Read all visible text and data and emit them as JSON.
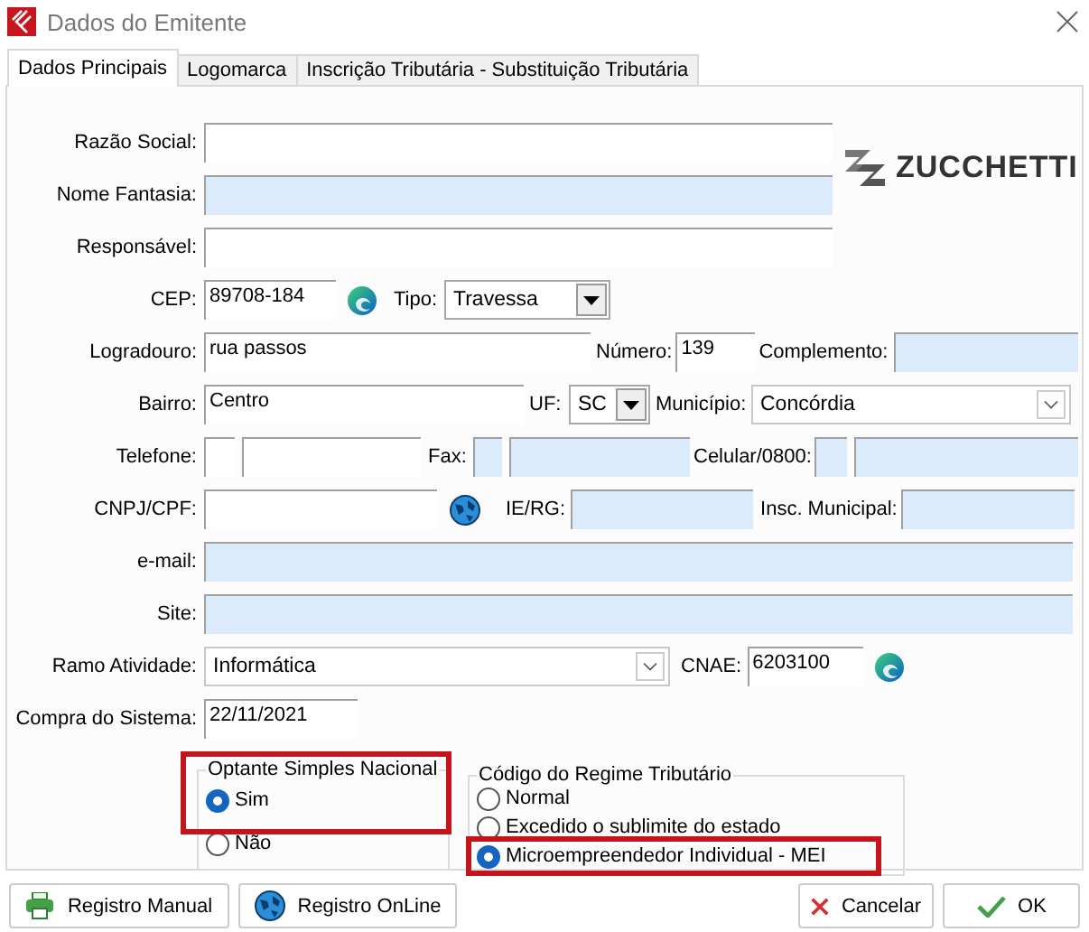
{
  "window": {
    "title": "Dados do Emitente"
  },
  "tabs": [
    {
      "label": "Dados Principais",
      "selected": true
    },
    {
      "label": "Logomarca",
      "selected": false
    },
    {
      "label": "Inscrição Tributária - Substituição Tributária",
      "selected": false
    }
  ],
  "logo": {
    "text": "ZUCCHETTI"
  },
  "rows": [
    {
      "items": [
        {
          "kind": "label",
          "text": "Razão Social:"
        },
        {
          "kind": "field",
          "shaded": false
        }
      ]
    },
    {
      "items": [
        {
          "kind": "label",
          "text": "Nome Fantasia:"
        },
        {
          "kind": "field",
          "shaded": true
        }
      ]
    },
    {
      "items": [
        {
          "kind": "label",
          "text": "Responsável:"
        },
        {
          "kind": "field",
          "shaded": false
        }
      ]
    },
    {
      "items": [
        {
          "kind": "label",
          "text": "CEP:"
        },
        {
          "kind": "field",
          "value": "89708-184",
          "shaded": false
        },
        {
          "kind": "label",
          "text": "Tipo:"
        },
        {
          "kind": "select",
          "value": "Travessa"
        }
      ]
    },
    {
      "items": [
        {
          "kind": "label",
          "text": "Logradouro:"
        },
        {
          "kind": "field",
          "value": "rua passos",
          "shaded": false
        },
        {
          "kind": "label",
          "text": "Número:"
        },
        {
          "kind": "field",
          "value": "139",
          "shaded": false
        },
        {
          "kind": "label",
          "text": "Complemento:"
        },
        {
          "kind": "field",
          "shaded": true
        }
      ]
    },
    {
      "items": [
        {
          "kind": "label",
          "text": "Bairro:"
        },
        {
          "kind": "field",
          "value": "Centro",
          "shaded": false
        },
        {
          "kind": "label",
          "text": "UF:"
        },
        {
          "kind": "select",
          "value": "SC"
        },
        {
          "kind": "label",
          "text": "Município:"
        },
        {
          "kind": "combo",
          "value": "Concórdia"
        }
      ]
    },
    {
      "items": [
        {
          "kind": "label",
          "text": "Telefone:"
        },
        {
          "kind": "field",
          "shaded": false
        },
        {
          "kind": "field",
          "shaded": false
        },
        {
          "kind": "label",
          "text": "Fax:"
        },
        {
          "kind": "field",
          "shaded": true
        },
        {
          "kind": "field",
          "shaded": true
        },
        {
          "kind": "label",
          "text": "Celular/0800:"
        },
        {
          "kind": "field",
          "shaded": true
        },
        {
          "kind": "field",
          "shaded": true
        }
      ]
    },
    {
      "items": [
        {
          "kind": "label",
          "text": "CNPJ/CPF:"
        },
        {
          "kind": "field",
          "shaded": false
        },
        {
          "kind": "label",
          "text": "IE/RG:"
        },
        {
          "kind": "field",
          "shaded": true
        },
        {
          "kind": "label",
          "text": "Insc. Municipal:"
        },
        {
          "kind": "field",
          "shaded": true
        }
      ]
    },
    {
      "items": [
        {
          "kind": "label",
          "text": "e-mail:"
        },
        {
          "kind": "field",
          "shaded": true
        }
      ]
    },
    {
      "items": [
        {
          "kind": "label",
          "text": "Site:"
        },
        {
          "kind": "field",
          "shaded": true
        }
      ]
    },
    {
      "items": [
        {
          "kind": "label",
          "text": "Ramo Atividade:"
        },
        {
          "kind": "combo",
          "value": "Informática"
        },
        {
          "kind": "label",
          "text": "CNAE:"
        },
        {
          "kind": "field",
          "value": "6203100",
          "shaded": false
        }
      ]
    },
    {
      "items": [
        {
          "kind": "label",
          "text": "Compra do Sistema:"
        },
        {
          "kind": "field",
          "value": "22/11/2021",
          "shaded": false
        }
      ]
    }
  ],
  "groups": [
    {
      "title": "Optante Simples Nacional",
      "highlighted": true,
      "options": [
        {
          "label": "Sim",
          "selected": true,
          "highlighted": false
        },
        {
          "label": "Não",
          "selected": false,
          "highlighted": false
        }
      ]
    },
    {
      "title": "Código do Regime Tributário",
      "highlighted": false,
      "options": [
        {
          "label": "Normal",
          "selected": false,
          "highlighted": false
        },
        {
          "label": "Excedido o sublimite do estado",
          "selected": false,
          "highlighted": false
        },
        {
          "label": "Microempreendedor Individual - MEI",
          "selected": true,
          "highlighted": true
        }
      ]
    }
  ],
  "buttons": [
    {
      "label": "Registro Manual",
      "kind": "print"
    },
    {
      "label": "Registro OnLine",
      "kind": "online"
    },
    {
      "label": "Cancelar",
      "kind": "cancel"
    },
    {
      "label": "OK",
      "kind": "ok"
    }
  ]
}
